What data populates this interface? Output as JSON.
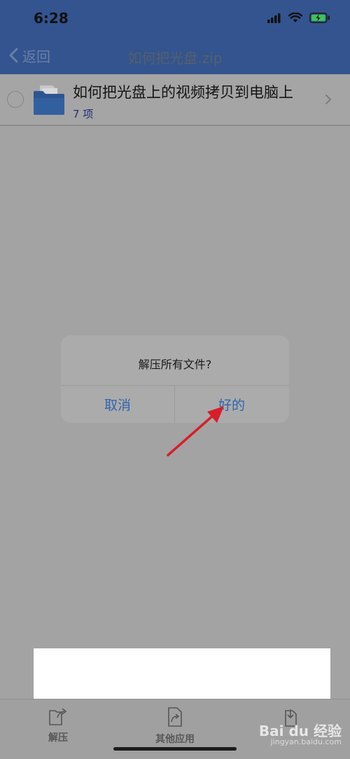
{
  "status_bar": {
    "time": "6:28"
  },
  "nav": {
    "back_label": "返回",
    "title": "如何把光盘.zip"
  },
  "file_item": {
    "name": "如何把光盘上的视频拷贝到电脑上",
    "count": "7 项"
  },
  "dialog": {
    "message": "解压所有文件?",
    "cancel_label": "取消",
    "ok_label": "好的"
  },
  "tab_bar": {
    "items": [
      {
        "label": "解压"
      },
      {
        "label": "其他应用"
      },
      {
        "label": ""
      }
    ]
  },
  "watermark": {
    "brand": "Bai du 经验",
    "url": "jingyan.baidu.com"
  },
  "colors": {
    "nav_bg": "#33548f",
    "dialog_button": "#2f65ad",
    "annotation_arrow": "#d81e2a"
  }
}
